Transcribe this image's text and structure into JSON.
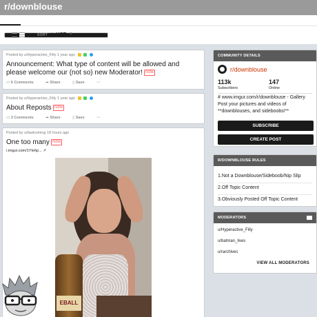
{
  "header": {
    "subreddit": "r/downblouse"
  },
  "sort": {
    "label": "SORT",
    "value": "HOT",
    "caret": "▾"
  },
  "posts": [
    {
      "meta": "Posted by u/Hyperactive_Filly 1 year ago",
      "title": "Announcement: What type of content will be allowed and please welcome our (not so) new Moderator!",
      "nsfw": "nsfw",
      "comments": "6 Comments",
      "share": "Share",
      "save": "Save",
      "more": "···"
    },
    {
      "meta": "Posted by u/Hyperactive_Filly 1 year ago",
      "title": "About Reposts",
      "nsfw": "nsfw",
      "comments": "3 Comments",
      "share": "Share",
      "save": "Save",
      "more": "···"
    },
    {
      "meta": "Posted by u/badcoming 18 hours ago",
      "title": "One too many",
      "nsfw": "nsfw",
      "link": "i.imgur.com/1YIe6p...",
      "photo_label": "EBALL"
    }
  ],
  "sidebar": {
    "community": {
      "header": "COMMUNITY DETAILS",
      "name": "r/downblouse",
      "subscribers": "113k",
      "subscribers_label": "Subscribers",
      "online": "147",
      "online_label": "Online",
      "description": "# www.imgur.com/r/downblouse - Gallery Post your pictures and videos of **downblouses, and sideboobs!**",
      "subscribe": "SUBSCRIBE",
      "create_post": "CREATE POST"
    },
    "rules": {
      "header": "R/DOWNBLOUSE RULES",
      "items": [
        "1.Not a Downblouse/Sideboob/Nip Slip",
        "2.Off Topic Content",
        "3.Obviously Posted Off Topic Content"
      ]
    },
    "moderators": {
      "header": "MODERATORS",
      "items": [
        "u/Hyperactive_Filly",
        "u/batman_lives",
        "u/rarchives"
      ],
      "view_all": "VIEW ALL MODERATORS"
    }
  },
  "colors": {
    "topbar": "#9a9a9a",
    "background": "#dae0e6",
    "accent": "#cc3300",
    "nsfw": "#ff585b",
    "button": "#1a1a1a"
  }
}
